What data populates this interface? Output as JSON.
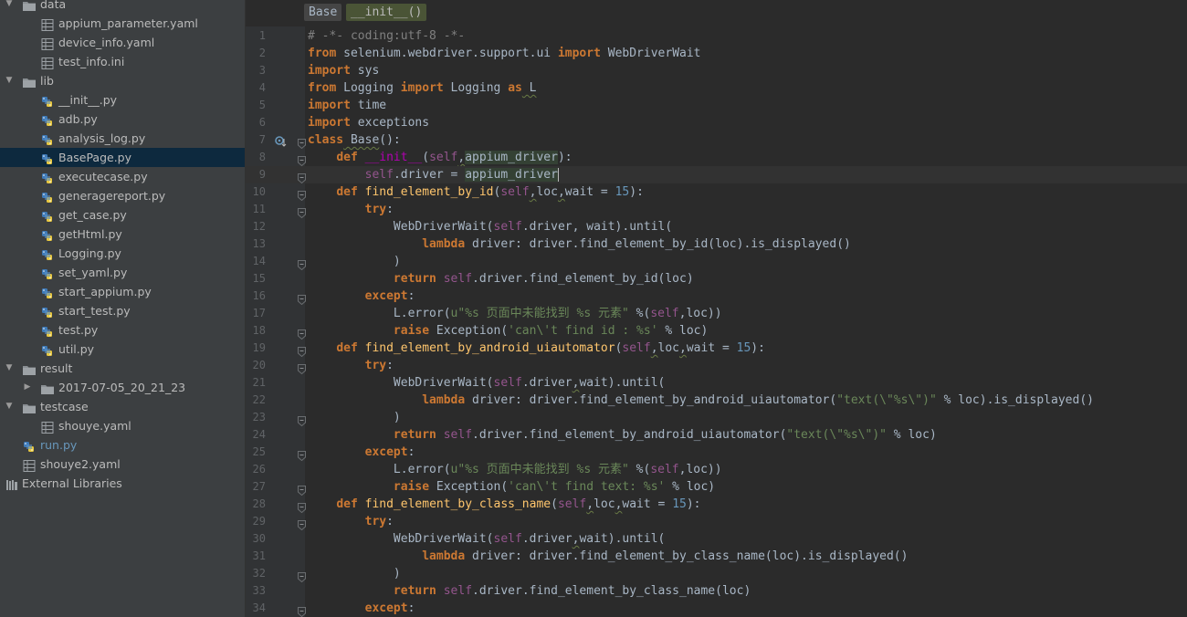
{
  "sidebar": {
    "items": [
      {
        "label": "data",
        "kind": "folder",
        "depth": 0,
        "expanded": true
      },
      {
        "label": "appium_parameter.yaml",
        "kind": "yaml",
        "depth": 1
      },
      {
        "label": "device_info.yaml",
        "kind": "yaml",
        "depth": 1
      },
      {
        "label": "test_info.ini",
        "kind": "ini",
        "depth": 1
      },
      {
        "label": "lib",
        "kind": "folder",
        "depth": 0,
        "expanded": true
      },
      {
        "label": "__init__.py",
        "kind": "py",
        "depth": 1
      },
      {
        "label": "adb.py",
        "kind": "py",
        "depth": 1
      },
      {
        "label": "analysis_log.py",
        "kind": "py",
        "depth": 1
      },
      {
        "label": "BasePage.py",
        "kind": "py",
        "depth": 1,
        "selected": true
      },
      {
        "label": "executecase.py",
        "kind": "py",
        "depth": 1
      },
      {
        "label": "generagereport.py",
        "kind": "py",
        "depth": 1
      },
      {
        "label": "get_case.py",
        "kind": "py",
        "depth": 1
      },
      {
        "label": "getHtml.py",
        "kind": "py",
        "depth": 1
      },
      {
        "label": "Logging.py",
        "kind": "py",
        "depth": 1
      },
      {
        "label": "set_yaml.py",
        "kind": "py",
        "depth": 1
      },
      {
        "label": "start_appium.py",
        "kind": "py",
        "depth": 1
      },
      {
        "label": "start_test.py",
        "kind": "py",
        "depth": 1
      },
      {
        "label": "test.py",
        "kind": "py",
        "depth": 1
      },
      {
        "label": "util.py",
        "kind": "py",
        "depth": 1
      },
      {
        "label": "result",
        "kind": "folder",
        "depth": 0,
        "expanded": true
      },
      {
        "label": "2017-07-05_20_21_23",
        "kind": "folder",
        "depth": 1,
        "expanded": false
      },
      {
        "label": "testcase",
        "kind": "folder",
        "depth": 0,
        "expanded": true
      },
      {
        "label": "shouye.yaml",
        "kind": "yaml",
        "depth": 1
      },
      {
        "label": "run.py",
        "kind": "py",
        "depth": 0,
        "modified": true
      },
      {
        "label": "shouye2.yaml",
        "kind": "yaml",
        "depth": 0
      },
      {
        "label": "External Libraries",
        "kind": "libs",
        "depth": -1
      }
    ]
  },
  "breadcrumb": [
    "Base",
    "__init__()"
  ],
  "editor": {
    "current_line": 9,
    "lines": [
      {
        "n": "1"
      },
      {
        "n": "2"
      },
      {
        "n": "3"
      },
      {
        "n": "4"
      },
      {
        "n": "5"
      },
      {
        "n": "6"
      },
      {
        "n": "7"
      },
      {
        "n": "8"
      },
      {
        "n": "9"
      },
      {
        "n": "10"
      },
      {
        "n": "11"
      },
      {
        "n": "12"
      },
      {
        "n": "13"
      },
      {
        "n": "14"
      },
      {
        "n": "15"
      },
      {
        "n": "16"
      },
      {
        "n": "17"
      },
      {
        "n": "18"
      },
      {
        "n": "19"
      },
      {
        "n": "20"
      },
      {
        "n": "21"
      },
      {
        "n": "22"
      },
      {
        "n": "23"
      },
      {
        "n": "24"
      },
      {
        "n": "25"
      },
      {
        "n": "26"
      },
      {
        "n": "27"
      },
      {
        "n": "28"
      },
      {
        "n": "29"
      },
      {
        "n": "30"
      },
      {
        "n": "31"
      },
      {
        "n": "32"
      },
      {
        "n": "33"
      },
      {
        "n": "34"
      }
    ],
    "code": [
      [
        [
          "cm",
          "# -*- coding:utf-8 -*-"
        ]
      ],
      [
        [
          "kw",
          "from"
        ],
        [
          "",
          " selenium.webdriver.support.ui "
        ],
        [
          "kw",
          "import"
        ],
        [
          "",
          " WebDriverWait"
        ]
      ],
      [
        [
          "kw",
          "import"
        ],
        [
          "",
          " sys"
        ]
      ],
      [
        [
          "kw",
          "from"
        ],
        [
          "",
          " Logging "
        ],
        [
          "kw",
          "import"
        ],
        [
          "",
          " Logging "
        ],
        [
          "kw",
          "as"
        ],
        [
          "sq",
          " L"
        ]
      ],
      [
        [
          "kw",
          "import"
        ],
        [
          "",
          " time"
        ]
      ],
      [
        [
          "kw",
          "import"
        ],
        [
          "",
          " exceptions"
        ]
      ],
      [
        [
          "kw",
          "class"
        ],
        [
          "sq",
          " Base"
        ],
        [
          "",
          "():"
        ]
      ],
      [
        [
          "",
          "    "
        ],
        [
          "kw",
          "def"
        ],
        [
          "",
          " "
        ],
        [
          "dunder",
          "__init__"
        ],
        [
          "",
          "("
        ],
        [
          "sf",
          "self"
        ],
        [
          "sq",
          ","
        ],
        [
          "hl",
          "appium_driver"
        ],
        [
          "",
          "):"
        ]
      ],
      [
        [
          "",
          "        "
        ],
        [
          "sf",
          "self"
        ],
        [
          "",
          ".driver = "
        ],
        [
          "hl",
          "appium_driver"
        ],
        [
          "caret",
          ""
        ]
      ],
      [
        [
          "",
          "    "
        ],
        [
          "kw",
          "def"
        ],
        [
          "",
          " "
        ],
        [
          "fn",
          "find_element_by_id"
        ],
        [
          "",
          "("
        ],
        [
          "sf",
          "self"
        ],
        [
          "sq",
          ","
        ],
        [
          "",
          "loc"
        ],
        [
          "sq",
          ","
        ],
        [
          "",
          "wait = "
        ],
        [
          "nm",
          "15"
        ],
        [
          "",
          "):"
        ]
      ],
      [
        [
          "",
          "        "
        ],
        [
          "kw",
          "try"
        ],
        [
          "",
          ":"
        ]
      ],
      [
        [
          "",
          "            WebDriverWait("
        ],
        [
          "sf",
          "self"
        ],
        [
          "",
          ".driver, wait).until("
        ]
      ],
      [
        [
          "",
          "                "
        ],
        [
          "kw",
          "lambda"
        ],
        [
          "",
          " driver: driver.find_element_by_id(loc).is_displayed()"
        ]
      ],
      [
        [
          "",
          "            )"
        ]
      ],
      [
        [
          "",
          "            "
        ],
        [
          "kw",
          "return"
        ],
        [
          "",
          " "
        ],
        [
          "sf",
          "self"
        ],
        [
          "",
          ".driver.find_element_by_id(loc)"
        ]
      ],
      [
        [
          "",
          "        "
        ],
        [
          "kw",
          "except"
        ],
        [
          "",
          ":"
        ]
      ],
      [
        [
          "",
          "            L.error("
        ],
        [
          "st",
          "u\"%s 页面中未能找到 %s 元素\""
        ],
        [
          "",
          " %("
        ],
        [
          "sf",
          "self"
        ],
        [
          "",
          ",loc))"
        ]
      ],
      [
        [
          "",
          "            "
        ],
        [
          "kw",
          "raise"
        ],
        [
          "",
          " Exception("
        ],
        [
          "st",
          "'can\\'t find id : %s'"
        ],
        [
          "",
          " % loc)"
        ]
      ],
      [
        [
          "",
          "    "
        ],
        [
          "kw",
          "def"
        ],
        [
          "",
          " "
        ],
        [
          "fn",
          "find_element_by_android_uiautomator"
        ],
        [
          "",
          "("
        ],
        [
          "sf",
          "self"
        ],
        [
          "sq",
          ","
        ],
        [
          "",
          "loc"
        ],
        [
          "sq",
          ","
        ],
        [
          "",
          "wait = "
        ],
        [
          "nm",
          "15"
        ],
        [
          "",
          "):"
        ]
      ],
      [
        [
          "",
          "        "
        ],
        [
          "kw",
          "try"
        ],
        [
          "",
          ":"
        ]
      ],
      [
        [
          "",
          "            WebDriverWait("
        ],
        [
          "sf",
          "self"
        ],
        [
          "",
          ".driver"
        ],
        [
          "sq",
          ","
        ],
        [
          "",
          "wait).until("
        ]
      ],
      [
        [
          "",
          "                "
        ],
        [
          "kw",
          "lambda"
        ],
        [
          "",
          " driver: driver.find_element_by_android_uiautomator("
        ],
        [
          "st",
          "\"text(\\\"%s\\\")\""
        ],
        [
          "",
          " % loc).is_displayed()"
        ]
      ],
      [
        [
          "",
          "            )"
        ]
      ],
      [
        [
          "",
          "            "
        ],
        [
          "kw",
          "return"
        ],
        [
          "",
          " "
        ],
        [
          "sf",
          "self"
        ],
        [
          "",
          ".driver.find_element_by_android_uiautomator("
        ],
        [
          "st",
          "\"text(\\\"%s\\\")\""
        ],
        [
          "",
          " % loc)"
        ]
      ],
      [
        [
          "",
          "        "
        ],
        [
          "kw",
          "except"
        ],
        [
          "",
          ":"
        ]
      ],
      [
        [
          "",
          "            L.error("
        ],
        [
          "st",
          "u\"%s 页面中未能找到 %s 元素\""
        ],
        [
          "",
          " %("
        ],
        [
          "sf",
          "self"
        ],
        [
          "",
          ",loc))"
        ]
      ],
      [
        [
          "",
          "            "
        ],
        [
          "kw",
          "raise"
        ],
        [
          "",
          " Exception("
        ],
        [
          "st",
          "'can\\'t find text: %s'"
        ],
        [
          "",
          " % loc)"
        ]
      ],
      [
        [
          "",
          "    "
        ],
        [
          "kw",
          "def"
        ],
        [
          "",
          " "
        ],
        [
          "fn",
          "find_element_by_class_name"
        ],
        [
          "",
          "("
        ],
        [
          "sf",
          "self"
        ],
        [
          "sq",
          ","
        ],
        [
          "",
          "loc"
        ],
        [
          "sq",
          ","
        ],
        [
          "",
          "wait = "
        ],
        [
          "nm",
          "15"
        ],
        [
          "",
          "):"
        ]
      ],
      [
        [
          "",
          "        "
        ],
        [
          "kw",
          "try"
        ],
        [
          "",
          ":"
        ]
      ],
      [
        [
          "",
          "            WebDriverWait("
        ],
        [
          "sf",
          "self"
        ],
        [
          "",
          ".driver"
        ],
        [
          "sq",
          ","
        ],
        [
          "",
          "wait).until("
        ]
      ],
      [
        [
          "",
          "                "
        ],
        [
          "kw",
          "lambda"
        ],
        [
          "",
          " driver: driver.find_element_by_class_name(loc).is_displayed()"
        ]
      ],
      [
        [
          "",
          "            )"
        ]
      ],
      [
        [
          "",
          "            "
        ],
        [
          "kw",
          "return"
        ],
        [
          "",
          " "
        ],
        [
          "sf",
          "self"
        ],
        [
          "",
          ".driver.find_element_by_class_name(loc)"
        ]
      ],
      [
        [
          "",
          "        "
        ],
        [
          "kw",
          "except"
        ],
        [
          "",
          ":"
        ]
      ]
    ]
  },
  "colors": {
    "background": "#2b2b2b",
    "sidebar": "#3c3f41",
    "keyword": "#cc7832",
    "function": "#ffc66d",
    "self": "#94558d",
    "string": "#6a8759",
    "number": "#6897bb",
    "selection": "#0d293e"
  }
}
